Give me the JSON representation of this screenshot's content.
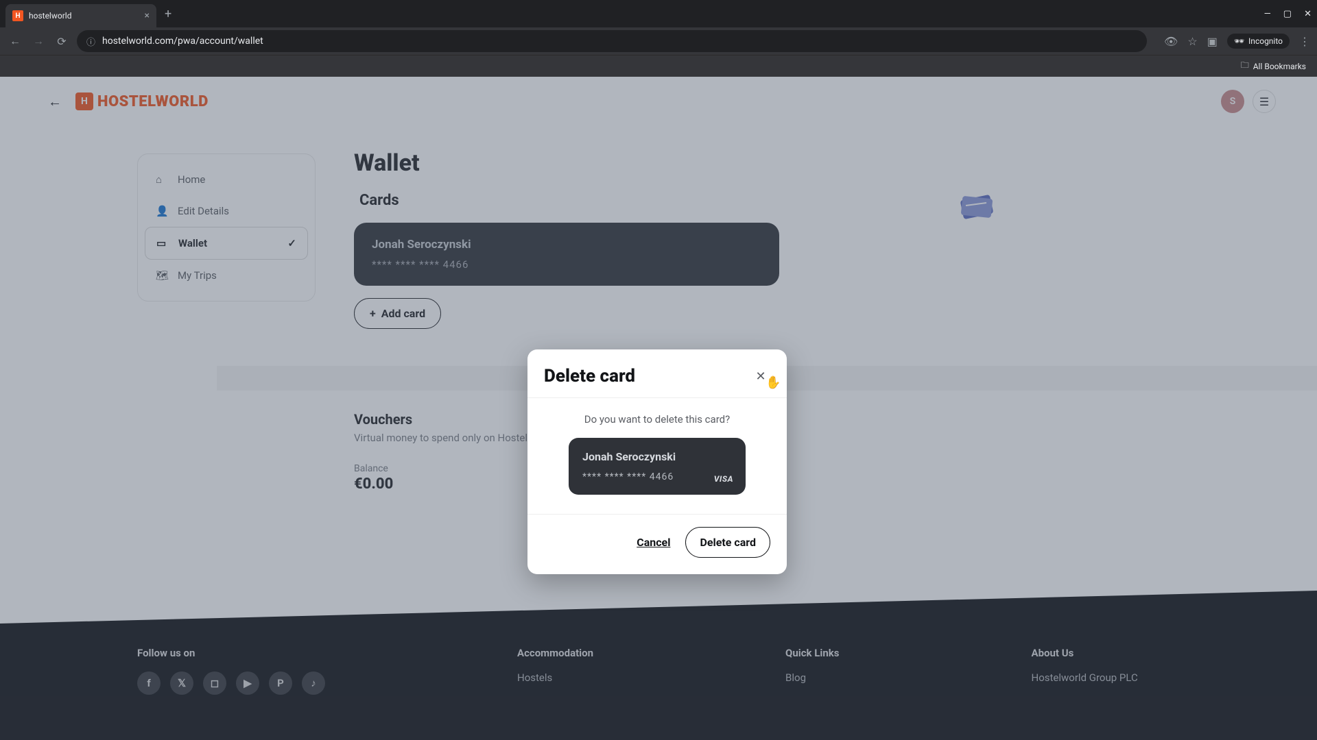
{
  "browser": {
    "tab_title": "hostelworld",
    "url": "hostelworld.com/pwa/account/wallet",
    "incognito_label": "Incognito",
    "all_bookmarks": "All Bookmarks"
  },
  "header": {
    "logo_text": "HOSTELWORLD",
    "avatar_initial": "S"
  },
  "sidebar": {
    "items": [
      {
        "label": "Home"
      },
      {
        "label": "Edit Details"
      },
      {
        "label": "Wallet"
      },
      {
        "label": "My Trips"
      }
    ]
  },
  "wallet": {
    "title": "Wallet",
    "cards_title": "Cards",
    "card": {
      "name": "Jonah Seroczynski",
      "masked": "**** **** **** 4466"
    },
    "add_card_label": "Add card",
    "vouchers_title": "Vouchers",
    "vouchers_sub": "Virtual money to spend only on Hostelworld",
    "balance_label": "Balance",
    "balance_value": "€0.00"
  },
  "modal": {
    "title": "Delete card",
    "message": "Do you want to delete this card?",
    "card_name": "Jonah Seroczynski",
    "card_masked": "**** **** **** 4466",
    "card_brand": "VISA",
    "cancel": "Cancel",
    "delete": "Delete card"
  },
  "footer": {
    "follow": "Follow us on",
    "accommodation": "Accommodation",
    "accommodation_link": "Hostels",
    "quick": "Quick Links",
    "quick_link": "Blog",
    "about": "About Us",
    "about_link": "Hostelworld Group PLC"
  }
}
